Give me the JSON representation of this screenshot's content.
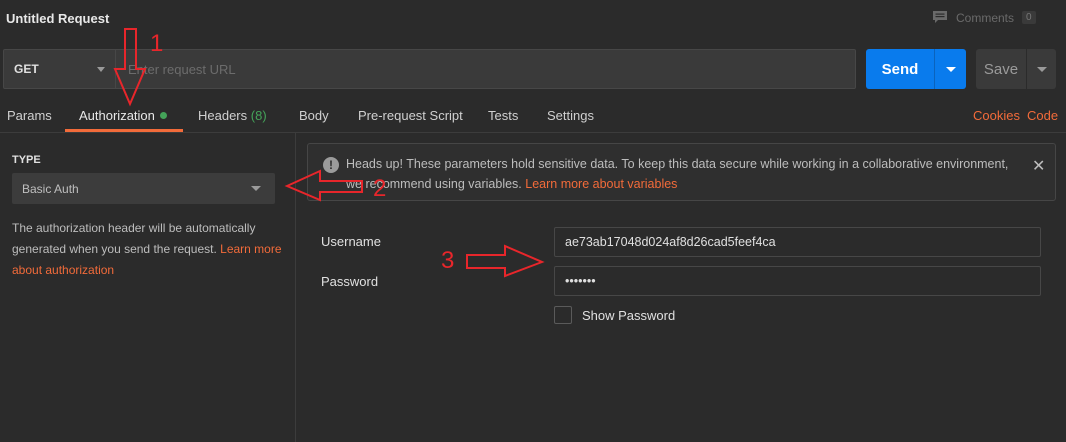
{
  "header": {
    "title": "Untitled Request",
    "comments_label": "Comments",
    "comments_count": "0"
  },
  "request": {
    "method": "GET",
    "url_placeholder": "Enter request URL",
    "send_label": "Send",
    "save_label": "Save"
  },
  "tabs": {
    "params": "Params",
    "authorization": "Authorization",
    "headers": "Headers",
    "headers_count": "(8)",
    "body": "Body",
    "prerequest": "Pre-request Script",
    "tests": "Tests",
    "settings": "Settings",
    "cookies": "Cookies",
    "code": "Code"
  },
  "auth": {
    "type_label": "TYPE",
    "type_value": "Basic Auth",
    "description": "The authorization header will be automatically generated when you send the request. ",
    "learn_more": "Learn more about authorization"
  },
  "alert": {
    "icon": "!",
    "text": "Heads up! These parameters hold sensitive data. To keep this data secure while working in a collaborative environment, we recommend using variables. ",
    "link": "Learn more about variables",
    "close": "✕"
  },
  "form": {
    "username_label": "Username",
    "username_value": "ae73ab17048d024af8d26cad5feef4ca",
    "password_label": "Password",
    "password_value": "1234567",
    "show_password_label": "Show Password"
  },
  "annotations": {
    "n1": "1",
    "n2": "2",
    "n3": "3",
    "color": "#e8262b"
  },
  "colors": {
    "accent": "#f26b3a",
    "send": "#097bed",
    "status_green": "#44a359"
  }
}
